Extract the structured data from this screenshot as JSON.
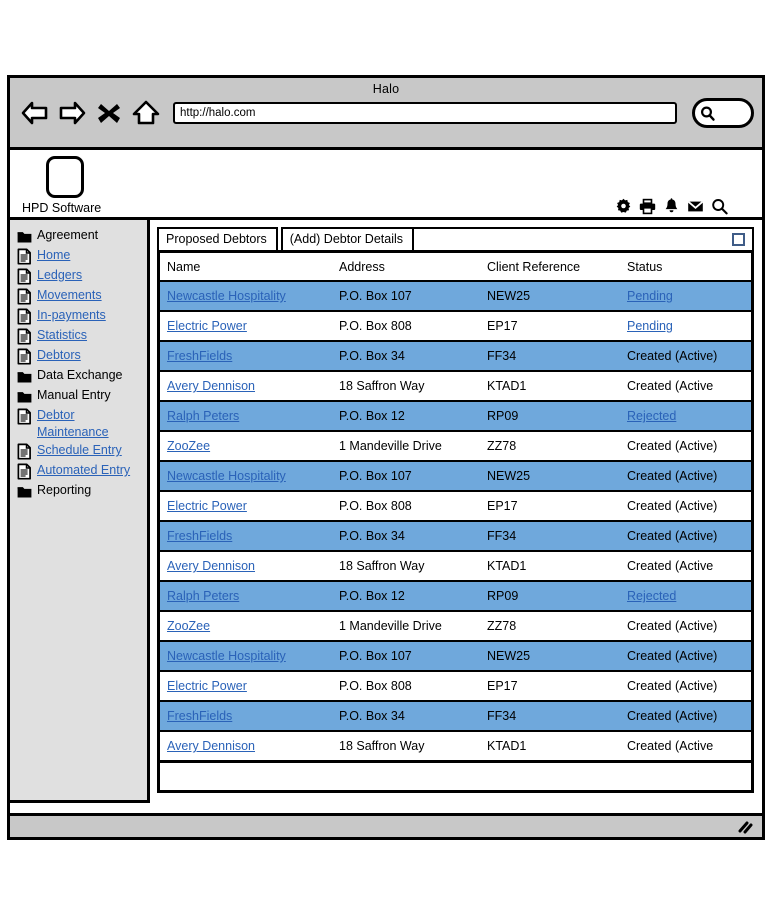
{
  "browser": {
    "title": "Halo",
    "url": "http://halo.com",
    "nav": [
      {
        "name": "back-icon",
        "label": "Back"
      },
      {
        "name": "forward-icon",
        "label": "Forward"
      },
      {
        "name": "stop-icon",
        "label": "Stop"
      },
      {
        "name": "home-icon",
        "label": "Home"
      }
    ],
    "search_icon": "search-icon"
  },
  "app": {
    "brand": "HPD Software",
    "logo": "logo-placeholder",
    "header_icons": [
      {
        "name": "gear-icon",
        "label": "Settings"
      },
      {
        "name": "printer-icon",
        "label": "Print"
      },
      {
        "name": "bell-icon",
        "label": "Notifications"
      },
      {
        "name": "envelope-icon",
        "label": "Messages"
      },
      {
        "name": "search-icon",
        "label": "Search"
      }
    ]
  },
  "sidebar": {
    "items": [
      {
        "label": "Agreement",
        "icon": "folder-icon",
        "link": false
      },
      {
        "label": "Home",
        "icon": "document-icon",
        "link": true
      },
      {
        "label": "Ledgers",
        "icon": "document-icon",
        "link": true
      },
      {
        "label": "Movements",
        "icon": "document-icon",
        "link": true
      },
      {
        "label": "In-payments",
        "icon": "document-icon",
        "link": true
      },
      {
        "label": "Statistics",
        "icon": "document-icon",
        "link": true
      },
      {
        "label": "Debtors",
        "icon": "document-icon",
        "link": true
      },
      {
        "label": "Data Exchange",
        "icon": "folder-icon",
        "link": false
      },
      {
        "label": "Manual Entry",
        "icon": "folder-icon",
        "link": false
      },
      {
        "label": "Debtor Maintenance",
        "icon": "document-icon",
        "link": true
      },
      {
        "label": "Schedule Entry",
        "icon": "document-icon",
        "link": true
      },
      {
        "label": "Automated Entry",
        "icon": "document-icon",
        "link": true
      },
      {
        "label": "Reporting",
        "icon": "folder-icon",
        "link": false
      }
    ]
  },
  "main": {
    "tabs": [
      {
        "label": "Proposed Debtors",
        "active": true
      },
      {
        "label": "(Add) Debtor Details",
        "active": false
      }
    ],
    "select_all_checkbox": {
      "checked": false
    },
    "table": {
      "columns": [
        "Name",
        "Address",
        "Client Reference",
        "Status"
      ],
      "rows": [
        {
          "name": "Newcastle Hospitality",
          "address": "P.O. Box 107",
          "reference": "NEW25",
          "status": "Pending",
          "status_link": true
        },
        {
          "name": "Electric Power",
          "address": "P.O. Box 808",
          "reference": "EP17",
          "status": "Pending",
          "status_link": true
        },
        {
          "name": "FreshFields",
          "address": "P.O. Box 34",
          "reference": "FF34",
          "status": "Created (Active)",
          "status_link": false
        },
        {
          "name": "Avery Dennison",
          "address": "18 Saffron Way",
          "reference": "KTAD1",
          "status": "Created (Active",
          "status_link": false
        },
        {
          "name": "Ralph Peters",
          "address": "P.O. Box 12",
          "reference": "RP09",
          "status": "Rejected",
          "status_link": true
        },
        {
          "name": "ZooZee",
          "address": "1 Mandeville Drive",
          "reference": "ZZ78",
          "status": "Created (Active)",
          "status_link": false
        },
        {
          "name": "Newcastle Hospitality",
          "address": "P.O. Box 107",
          "reference": "NEW25",
          "status": "Created (Active)",
          "status_link": false
        },
        {
          "name": "Electric Power",
          "address": "P.O. Box 808",
          "reference": "EP17",
          "status": "Created (Active)",
          "status_link": false
        },
        {
          "name": "FreshFields",
          "address": "P.O. Box 34",
          "reference": "FF34",
          "status": "Created (Active)",
          "status_link": false
        },
        {
          "name": "Avery Dennison",
          "address": "18 Saffron Way",
          "reference": "KTAD1",
          "status": "Created (Active",
          "status_link": false
        },
        {
          "name": "Ralph Peters",
          "address": "P.O. Box 12",
          "reference": "RP09",
          "status": "Rejected",
          "status_link": true
        },
        {
          "name": "ZooZee",
          "address": "1 Mandeville Drive",
          "reference": "ZZ78",
          "status": "Created (Active)",
          "status_link": false
        },
        {
          "name": "Newcastle Hospitality",
          "address": "P.O. Box 107",
          "reference": "NEW25",
          "status": "Created (Active)",
          "status_link": false
        },
        {
          "name": "Electric Power",
          "address": "P.O. Box 808",
          "reference": "EP17",
          "status": "Created (Active)",
          "status_link": false
        },
        {
          "name": "FreshFields",
          "address": "P.O. Box 34",
          "reference": "FF34",
          "status": "Created (Active)",
          "status_link": false
        },
        {
          "name": "Avery Dennison",
          "address": "18 Saffron Way",
          "reference": "KTAD1",
          "status": "Created (Active",
          "status_link": false
        }
      ]
    }
  },
  "statusbar": {
    "resize_grip": "resize-grip-icon"
  },
  "colors": {
    "row_highlight": "#6fa8dc",
    "link": "#2a62b8",
    "chrome": "#c8c8c8",
    "sidebar": "#e0e0e0"
  }
}
